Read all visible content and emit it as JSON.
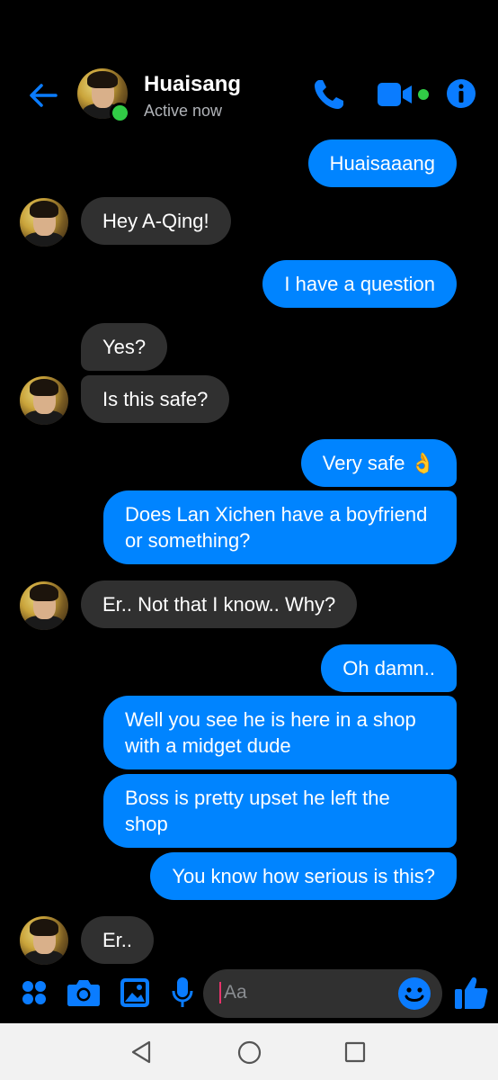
{
  "header": {
    "name": "Huaisang",
    "status": "Active now",
    "icons": [
      "back-arrow-icon",
      "phone-icon",
      "video-icon",
      "info-icon"
    ],
    "online": true
  },
  "messages": [
    {
      "side": "out",
      "text": "Huaisaaang"
    },
    {
      "side": "in",
      "text": "Hey A-Qing!"
    },
    {
      "side": "out",
      "text": "I have a question"
    },
    {
      "side": "in",
      "text": "Yes?"
    },
    {
      "side": "in",
      "text": "Is this safe?"
    },
    {
      "side": "out",
      "text": "Very safe 👌"
    },
    {
      "side": "out",
      "text": "Does Lan Xichen have a boyfriend or something?"
    },
    {
      "side": "in",
      "text": "Er.. Not that I know.. Why?"
    },
    {
      "side": "out",
      "text": "Oh damn.."
    },
    {
      "side": "out",
      "text": "Well you see he is here in a shop with a midget dude"
    },
    {
      "side": "out",
      "text": "Boss is pretty upset he left the shop"
    },
    {
      "side": "out",
      "text": "You know how serious is this?"
    },
    {
      "side": "in",
      "text": "Er.."
    }
  ],
  "composer": {
    "placeholder": "Aa",
    "icons": [
      "menu-dots-icon",
      "camera-icon",
      "gallery-icon",
      "microphone-icon",
      "emoji-icon",
      "like-icon"
    ]
  },
  "colors": {
    "accent": "#0084ff",
    "incoming": "#303030",
    "online": "#31cc46",
    "background": "#000000"
  }
}
